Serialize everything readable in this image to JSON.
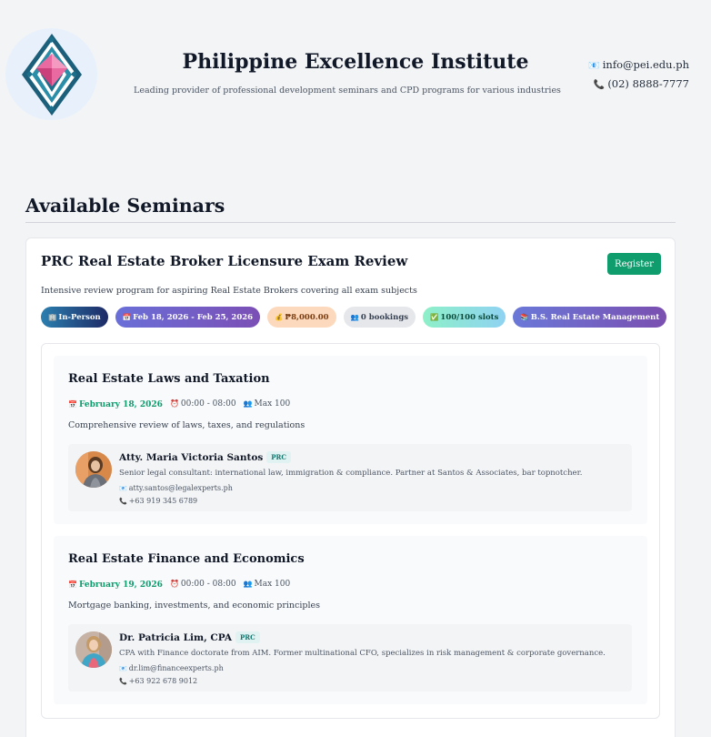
{
  "header": {
    "title": "Philippine Excellence Institute",
    "subtitle": "Leading provider of professional development seminars and CPD programs for various industries",
    "email": "info@pei.edu.ph",
    "phone": "(02) 8888-7777",
    "email_icon": "📧",
    "phone_icon": "📞"
  },
  "section": {
    "title": "Available Seminars"
  },
  "seminar": {
    "title": "PRC Real Estate Broker Licensure Exam Review",
    "register_label": "Register",
    "description": "Intensive review program for aspiring Real Estate Brokers covering all exam subjects",
    "badges": [
      {
        "icon": "🏢",
        "label": "In-Person"
      },
      {
        "icon": "📅",
        "label": "Feb 18, 2026 - Feb 25, 2026"
      },
      {
        "icon": "💰",
        "label": "₱8,000.00"
      },
      {
        "icon": "👥",
        "label": "0 bookings"
      },
      {
        "icon": "✅",
        "label": "100/100 slots"
      },
      {
        "icon": "📚",
        "label": "B.S. Real Estate Management"
      }
    ],
    "sessions": [
      {
        "title": "Real Estate Laws and Taxation",
        "date": "February 18, 2026",
        "time": "00:00 - 08:00",
        "capacity": "Max 100",
        "description": "Comprehensive review of laws, taxes, and regulations",
        "speaker": {
          "name": "Atty. Maria Victoria Santos",
          "tag": "PRC",
          "bio": "Senior legal consultant: international law, immigration & compliance. Partner at Santos & Associates, bar topnotcher.",
          "email": "atty.santos@legalexperts.ph",
          "phone": "+63 919 345 6789"
        }
      },
      {
        "title": "Real Estate Finance and Economics",
        "date": "February 19, 2026",
        "time": "00:00 - 08:00",
        "capacity": "Max 100",
        "description": "Mortgage banking, investments, and economic principles",
        "speaker": {
          "name": "Dr. Patricia Lim, CPA",
          "tag": "PRC",
          "bio": "CPA with Finance doctorate from AIM. Former multinational CFO, specializes in risk management & corporate governance.",
          "email": "dr.lim@financeexperts.ph",
          "phone": "+63 922 678 9012"
        }
      }
    ],
    "meta_icons": {
      "date": "📅",
      "time": "⏰",
      "capacity": "👥",
      "email": "📧",
      "phone": "📞"
    }
  },
  "colors": {
    "accent_green": "#0f9d6e",
    "logo_teal": "#1b6f8a",
    "logo_pink": "#e0508a"
  }
}
